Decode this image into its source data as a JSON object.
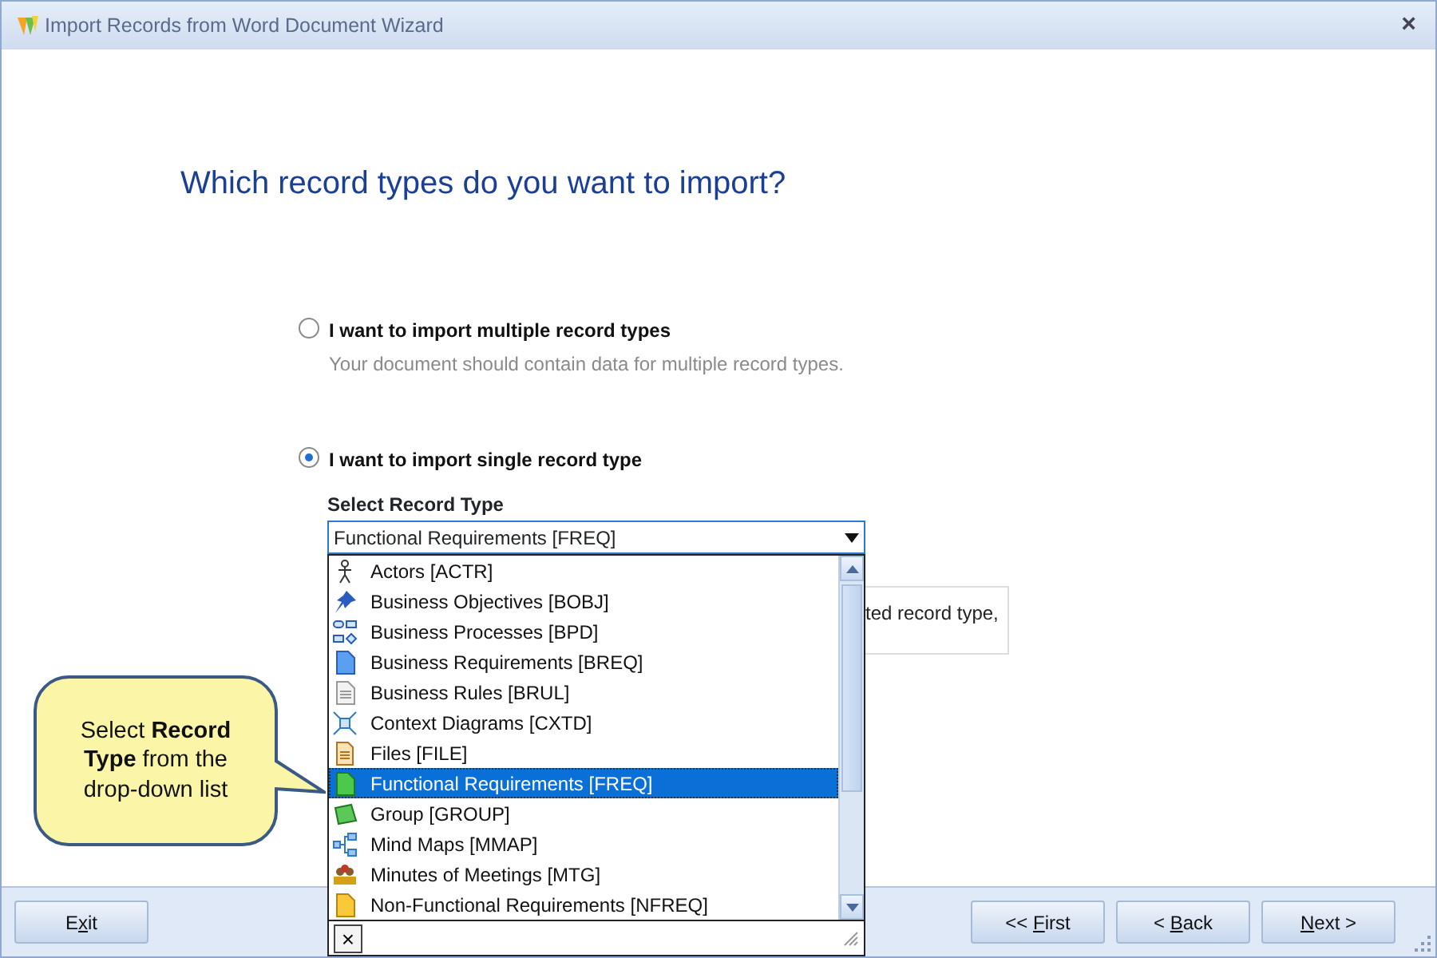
{
  "window": {
    "title": "Import Records from Word Document Wizard",
    "close": "×"
  },
  "heading": "Which record types do you want to import?",
  "options": [
    {
      "label": "I want to import multiple record types",
      "description": "Your document should contain data for multiple record types.",
      "selected": false
    },
    {
      "label": "I want to import single record type",
      "selected": true
    }
  ],
  "record_type": {
    "label": "Select Record Type",
    "value": "Functional Requirements [FREQ]",
    "expanded": true,
    "items": [
      {
        "label": "Actors [ACTR]",
        "kind": "actor",
        "selected": false
      },
      {
        "label": "Business Objectives [BOBJ]",
        "kind": "pin",
        "selected": false
      },
      {
        "label": "Business Processes [BPD]",
        "kind": "process",
        "selected": false
      },
      {
        "label": "Business Requirements [BREQ]",
        "kind": "doc-blue",
        "selected": false
      },
      {
        "label": "Business Rules [BRUL]",
        "kind": "doc-grey",
        "selected": false
      },
      {
        "label": "Context Diagrams [CXTD]",
        "kind": "context",
        "selected": false
      },
      {
        "label": "Files [FILE]",
        "kind": "file",
        "selected": false
      },
      {
        "label": "Functional Requirements [FREQ]",
        "kind": "doc-green",
        "selected": true
      },
      {
        "label": "Group [GROUP]",
        "kind": "group",
        "selected": false
      },
      {
        "label": "Mind Maps [MMAP]",
        "kind": "mindmap",
        "selected": false
      },
      {
        "label": "Minutes of Meetings [MTG]",
        "kind": "meeting",
        "selected": false
      },
      {
        "label": "Non-Functional Requirements [NFREQ]",
        "kind": "doc-yellow",
        "selected": false
      }
    ],
    "clear": "×"
  },
  "hidden_note": "ted record type,",
  "callout": "Select **Record Type** from the drop-down list",
  "buttons": [
    {
      "before": "E",
      "key": "x",
      "after": "it",
      "kind": "exit"
    },
    {
      "before": "<< ",
      "key": "F",
      "after": "irst",
      "kind": "nav"
    },
    {
      "before": "< ",
      "key": "B",
      "after": "ack",
      "kind": "nav"
    },
    {
      "key": "N",
      "after": "ext >",
      "kind": "nav"
    }
  ]
}
